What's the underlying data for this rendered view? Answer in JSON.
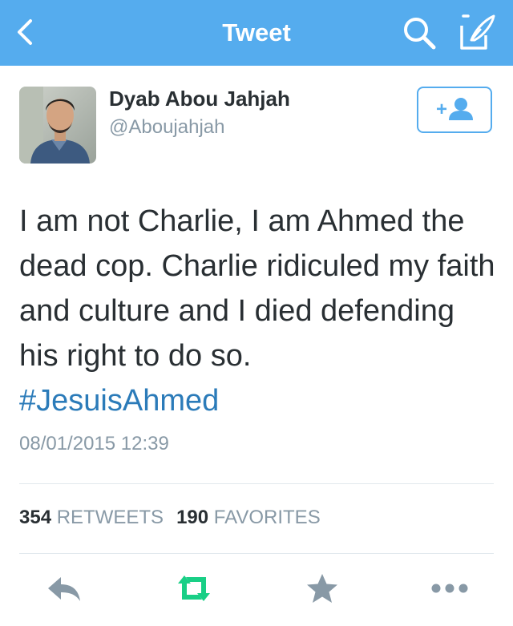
{
  "header": {
    "title": "Tweet",
    "bar_color": "#55acee",
    "icons": [
      "back-arrow-icon",
      "search-icon",
      "compose-icon"
    ]
  },
  "tweet": {
    "author_name": "Dyab Abou Jahjah",
    "author_handle": "@Aboujahjah",
    "text": "I am not Charlie, I am Ahmed the dead cop. Charlie ridiculed my faith and culture and I died defending his right to do so.",
    "hashtag": "#JesuisAhmed",
    "timestamp": "08/01/2015 12:39",
    "follow_icon": "add-user-icon"
  },
  "stats": {
    "retweets_count": "354",
    "retweets_label": "RETWEETS",
    "favorites_count": "190",
    "favorites_label": "FAVORITES"
  },
  "actions": {
    "icons": [
      "reply-icon",
      "retweet-icon",
      "favorite-star-icon",
      "more-icon"
    ],
    "retweet_color": "#19cf86",
    "icon_color": "#8899a6"
  }
}
